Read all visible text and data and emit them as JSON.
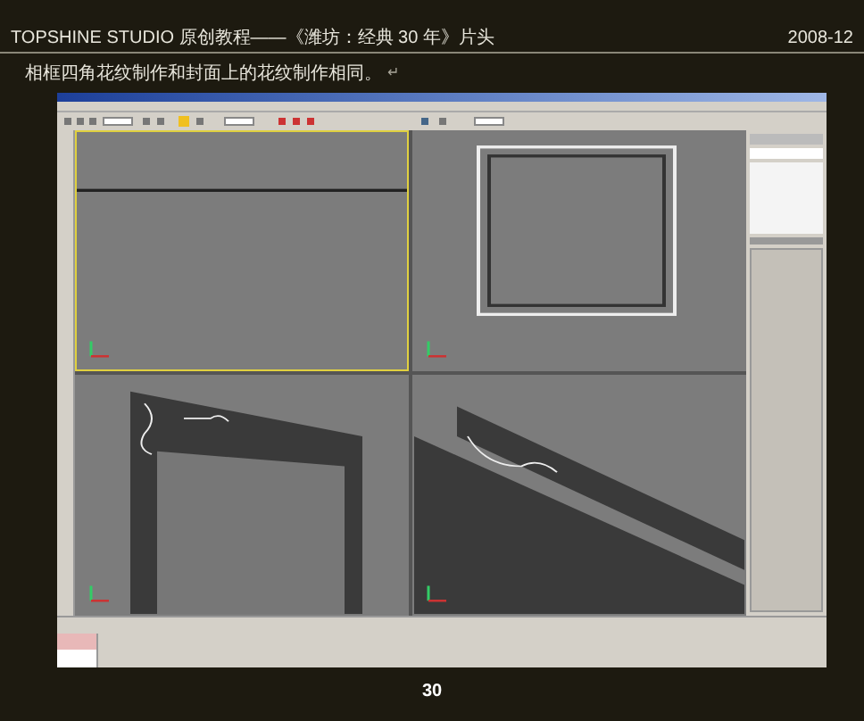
{
  "header": {
    "title": "TOPSHINE STUDIO 原创教程——《潍坊：经典 30 年》片头",
    "date": "2008-12"
  },
  "caption": {
    "text": "相框四角花纹制作和封面上的花纹制作相同。",
    "paragraph_mark": "↵"
  },
  "app": {
    "viewports": [
      {
        "kind": "edge",
        "selected": true
      },
      {
        "kind": "front",
        "selected": false
      },
      {
        "kind": "corner-left",
        "selected": false
      },
      {
        "kind": "corner-bottom",
        "selected": false
      }
    ]
  },
  "page_number": "30"
}
